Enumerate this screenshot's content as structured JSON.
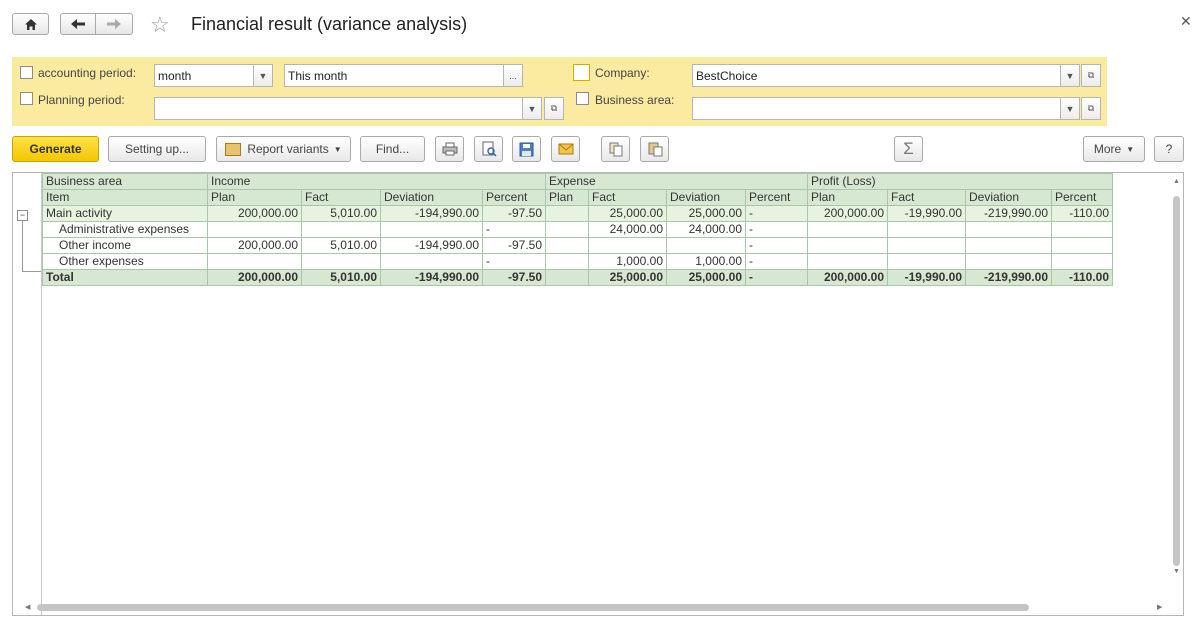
{
  "window": {
    "title": "Financial result (variance analysis)"
  },
  "filters": {
    "accounting_period": {
      "label": "accounting period:",
      "period_type": "month",
      "period_value": "This month",
      "checked": false
    },
    "planning_period": {
      "label": "Planning period:",
      "value": "",
      "checked": false
    },
    "company": {
      "label": "Company:",
      "value": "BestChoice",
      "checked": false
    },
    "business_area": {
      "label": "Business area:",
      "value": "",
      "checked": false
    }
  },
  "toolbar": {
    "generate": "Generate",
    "setting_up": "Setting up...",
    "report_variants": "Report variants",
    "find": "Find...",
    "more": "More",
    "help": "?",
    "sum": "Σ"
  },
  "table": {
    "header_row1": {
      "business_area": "Business area",
      "income": "Income",
      "expense": "Expense",
      "profit": "Profit (Loss)"
    },
    "header_row2": {
      "item": "Item",
      "plan": "Plan",
      "fact": "Fact",
      "deviation": "Deviation",
      "percent": "Percent"
    },
    "rows": [
      {
        "label": "Main activity",
        "inc_plan": "200,000.00",
        "inc_fact": "5,010.00",
        "inc_dev": "-194,990.00",
        "inc_pct": "-97.50",
        "exp_plan": "",
        "exp_fact": "25,000.00",
        "exp_dev": "25,000.00",
        "exp_pct": "-",
        "pl_plan": "200,000.00",
        "pl_fact": "-19,990.00",
        "pl_dev": "-219,990.00",
        "pl_pct": "-110.00"
      },
      {
        "label": "Administrative expenses",
        "inc_plan": "",
        "inc_fact": "",
        "inc_dev": "",
        "inc_pct": "-",
        "exp_plan": "",
        "exp_fact": "24,000.00",
        "exp_dev": "24,000.00",
        "exp_pct": "-",
        "pl_plan": "",
        "pl_fact": "",
        "pl_dev": "",
        "pl_pct": ""
      },
      {
        "label": "Other income",
        "inc_plan": "200,000.00",
        "inc_fact": "5,010.00",
        "inc_dev": "-194,990.00",
        "inc_pct": "-97.50",
        "exp_plan": "",
        "exp_fact": "",
        "exp_dev": "",
        "exp_pct": "-",
        "pl_plan": "",
        "pl_fact": "",
        "pl_dev": "",
        "pl_pct": ""
      },
      {
        "label": "Other expenses",
        "inc_plan": "",
        "inc_fact": "",
        "inc_dev": "",
        "inc_pct": "-",
        "exp_plan": "",
        "exp_fact": "1,000.00",
        "exp_dev": "1,000.00",
        "exp_pct": "-",
        "pl_plan": "",
        "pl_fact": "",
        "pl_dev": "",
        "pl_pct": ""
      },
      {
        "label": "Total",
        "inc_plan": "200,000.00",
        "inc_fact": "5,010.00",
        "inc_dev": "-194,990.00",
        "inc_pct": "-97.50",
        "exp_plan": "",
        "exp_fact": "25,000.00",
        "exp_dev": "25,000.00",
        "exp_pct": "-",
        "pl_plan": "200,000.00",
        "pl_fact": "-19,990.00",
        "pl_dev": "-219,990.00",
        "pl_pct": "-110.00"
      }
    ]
  },
  "icons": [
    "home-icon",
    "back-arrow-icon",
    "forward-arrow-icon",
    "favorite-star-icon",
    "close-icon",
    "print-icon",
    "preview-icon",
    "save-icon",
    "email-icon",
    "copy-icon",
    "paste-icon",
    "sum-icon",
    "collapse-icon"
  ]
}
